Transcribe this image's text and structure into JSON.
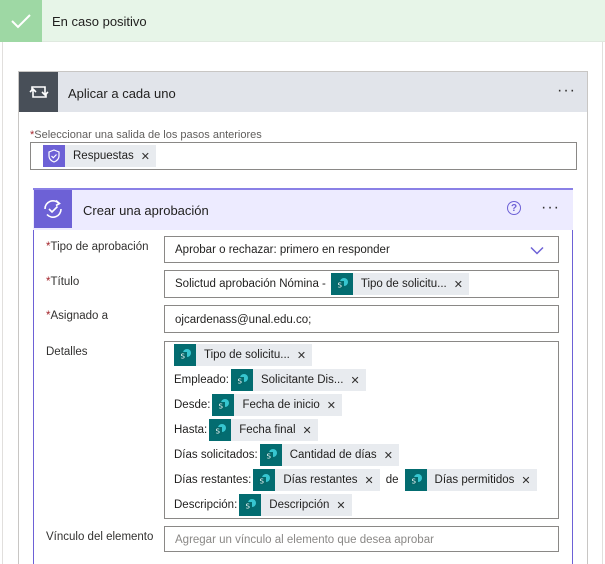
{
  "condition_branch": {
    "title": "En caso positivo"
  },
  "foreach": {
    "title": "Aplicar a cada uno",
    "select_label": "Seleccionar una salida de los pasos anteriores",
    "token_label": "Respuestas"
  },
  "approval": {
    "title": "Crear una aprobación",
    "fields": {
      "type": {
        "label": "Tipo de aprobación",
        "value": "Aprobar o rechazar: primero en responder"
      },
      "title": {
        "label": "Título",
        "prefix": "Solictud aprobación Nómina -",
        "token": "Tipo de solicitu..."
      },
      "assigned": {
        "label": "Asignado a",
        "value": "ojcardenass@unal.edu.co;"
      },
      "details": {
        "label": "Detalles",
        "lines": [
          {
            "prefix": "",
            "tokens": [
              "Tipo de solicitu..."
            ]
          },
          {
            "prefix": "Empleado:",
            "tokens": [
              "Solicitante Dis..."
            ]
          },
          {
            "prefix": "Desde:",
            "tokens": [
              "Fecha de inicio"
            ]
          },
          {
            "prefix": "Hasta:",
            "tokens": [
              "Fecha final"
            ]
          },
          {
            "prefix": "Días solicitados:",
            "tokens": [
              "Cantidad de días"
            ]
          },
          {
            "prefix": "Días restantes:",
            "tokens": [
              "Días restantes",
              "Días permitidos"
            ],
            "joiner": "de"
          },
          {
            "prefix": "Descripción:",
            "tokens": [
              "Descripción"
            ]
          }
        ]
      },
      "item_link": {
        "label": "Vínculo del elemento",
        "placeholder": "Agregar un vínculo al elemento que desea aprobar"
      }
    }
  },
  "icons": {
    "check": "check-icon",
    "loop": "loop-icon",
    "approval": "approval-icon",
    "sharepoint": "sharepoint-icon",
    "help": "help-icon",
    "more": "more-icon",
    "dropdown": "chevron-down-icon",
    "remove": "close-icon"
  },
  "colors": {
    "success_bg": "#e7f5e8",
    "success_accent": "#9ed8a4",
    "loop_header": "#484f58",
    "approval_accent": "#6d61d6",
    "sharepoint": "#036c70",
    "required": "#a4262c"
  }
}
